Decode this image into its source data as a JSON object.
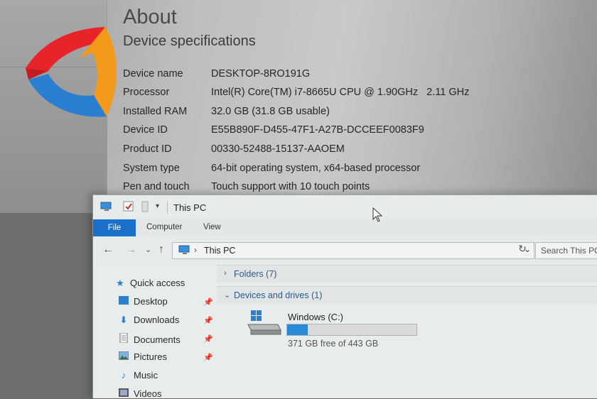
{
  "settings": {
    "title": "About",
    "heading": "Device specifications",
    "specs": [
      {
        "key": "Device name",
        "value": "DESKTOP-8RO191G"
      },
      {
        "key": "Processor",
        "value": "Intel(R) Core(TM) i7-8665U CPU @ 1.90GHz   2.11 GHz"
      },
      {
        "key": "Installed RAM",
        "value": "32.0 GB (31.8 GB usable)"
      },
      {
        "key": "Device ID",
        "value": "E55B890F-D455-47F1-A27B-DCCEEF0083F9"
      },
      {
        "key": "Product ID",
        "value": "00330-52488-15137-AAOEM"
      },
      {
        "key": "System type",
        "value": "64-bit operating system, x64-based processor"
      },
      {
        "key": "Pen and touch",
        "value": "Touch support with 10 touch points"
      }
    ]
  },
  "logo": {
    "colors": [
      "#e8242a",
      "#f39a1c",
      "#2b7fd1"
    ]
  },
  "explorer": {
    "title": "This PC",
    "ribbon_tabs": {
      "file": "File",
      "computer": "Computer",
      "view": "View"
    },
    "address": {
      "path": "This PC",
      "search_placeholder": "Search This PC"
    },
    "nav": {
      "quick_access": "Quick access",
      "items": [
        {
          "label": "Desktop",
          "icon": "desktop-icon"
        },
        {
          "label": "Downloads",
          "icon": "download-icon"
        },
        {
          "label": "Documents",
          "icon": "documents-icon"
        },
        {
          "label": "Pictures",
          "icon": "pictures-icon"
        },
        {
          "label": "Music",
          "icon": "music-icon"
        },
        {
          "label": "Videos",
          "icon": "videos-icon"
        }
      ]
    },
    "groups": {
      "folders": "Folders (7)",
      "devices": "Devices and drives (1)"
    },
    "drive": {
      "name": "Windows (C:)",
      "free_text": "371 GB free of 443 GB",
      "used_fraction": 0.16
    },
    "accent": "#1a6fc9"
  }
}
